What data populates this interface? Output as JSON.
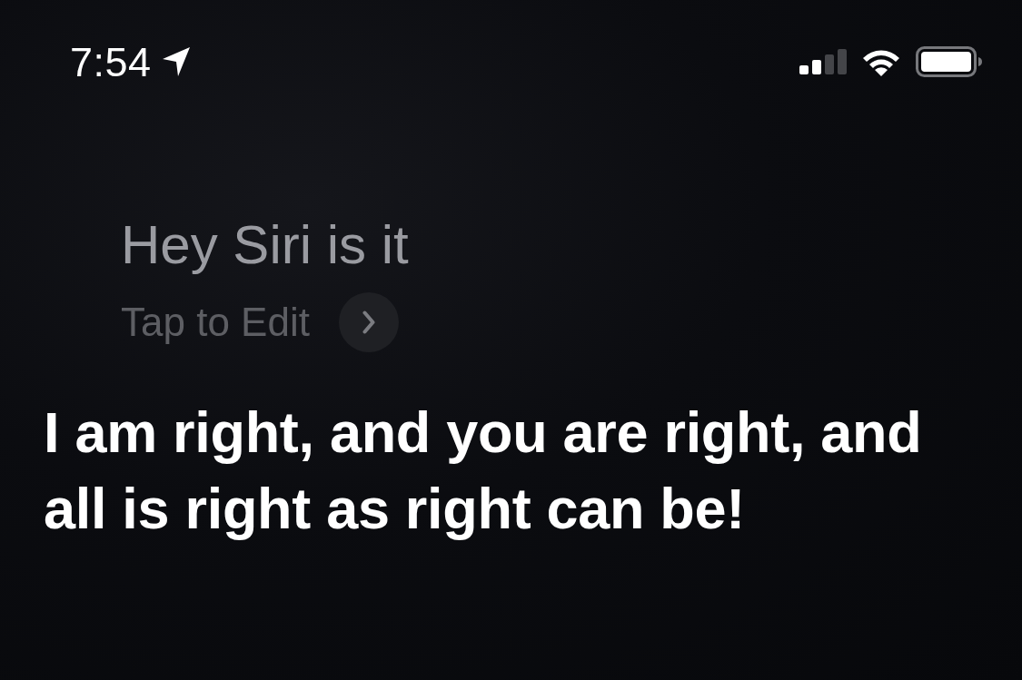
{
  "status_bar": {
    "time": "7:54"
  },
  "query": {
    "text": "Hey Siri is it",
    "edit_label": "Tap to Edit"
  },
  "response": {
    "text": "I am right, and you are right, and all is right as right can be!"
  }
}
